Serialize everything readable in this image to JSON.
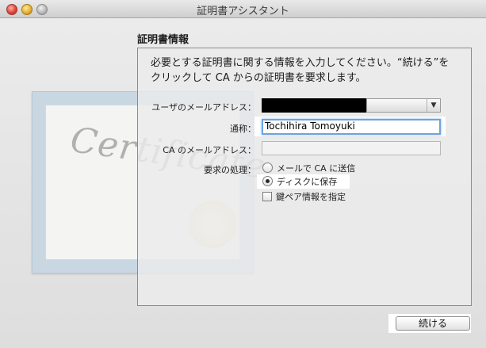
{
  "window": {
    "title": "証明書アシスタント"
  },
  "section": {
    "title": "証明書情報",
    "intro_line1": "必要とする証明書に関する情報を入力してください。“続ける”を",
    "intro_line2": "クリックして CA からの証明書を要求します。"
  },
  "form": {
    "email_label": "ユーザのメールアドレス：",
    "email_value": "",
    "name_label": "通称：",
    "name_value": "Tochihira Tomoyuki",
    "ca_email_label": "CA のメールアドレス：",
    "ca_email_value": "",
    "request_label": "要求の処理：",
    "options": {
      "email_ca": "メールで CA に送信",
      "save_disk": "ディスクに保存",
      "key_pair": "鍵ペア情報を指定"
    },
    "selected_option": "save_disk"
  },
  "artwork": {
    "word": "Certificate"
  },
  "buttons": {
    "continue": "続ける"
  }
}
